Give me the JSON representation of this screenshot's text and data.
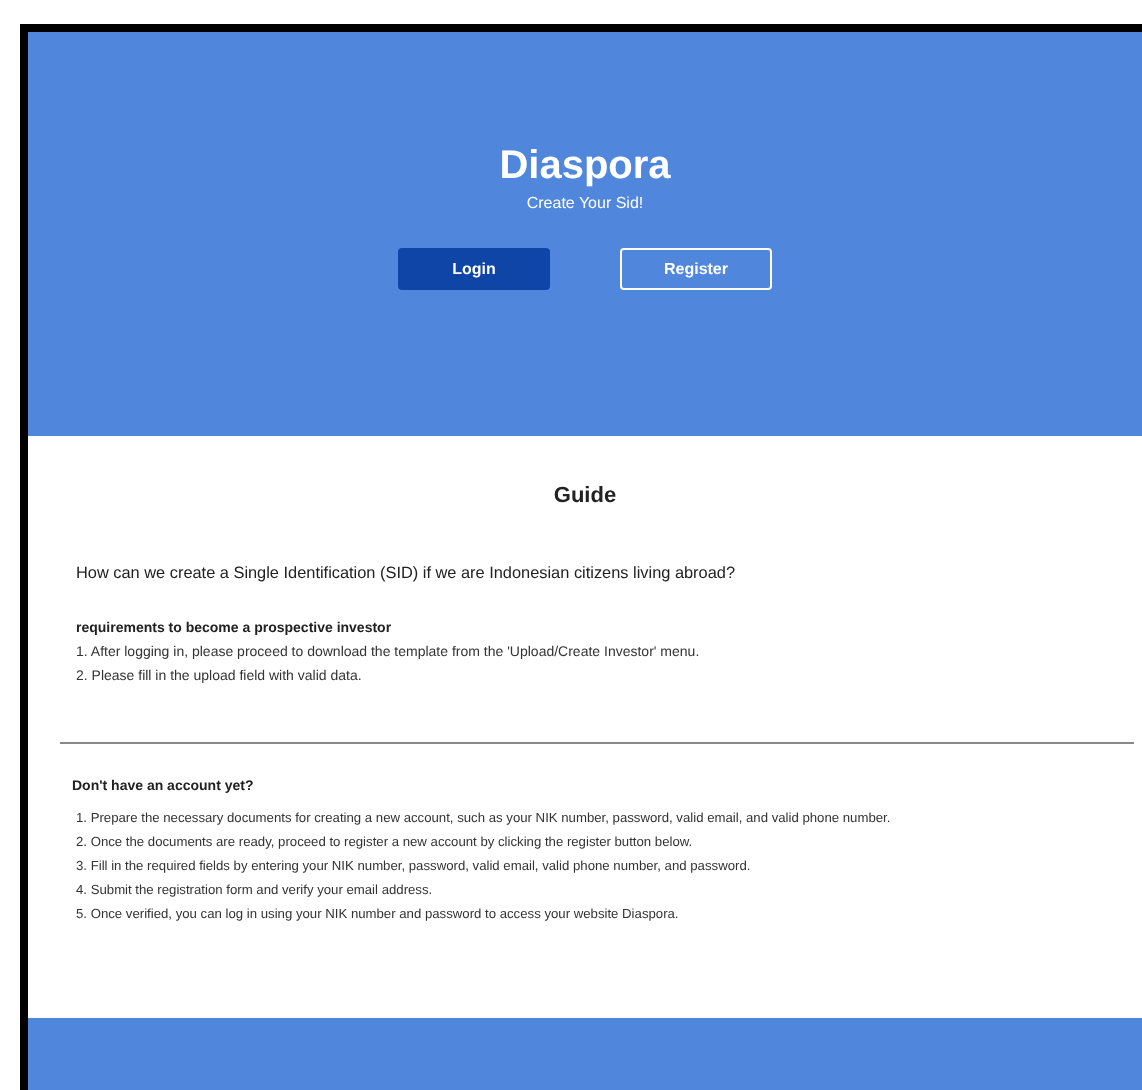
{
  "hero": {
    "title": "Diaspora",
    "subtitle": "Create Your Sid!",
    "buttons": [
      {
        "label": "Login",
        "kind": "solid"
      },
      {
        "label": "Register",
        "kind": "outline"
      }
    ]
  },
  "guide": {
    "title": "Guide",
    "question": "How can we create a Single Identification (SID) if we are Indonesian citizens living abroad?",
    "requirements_heading": "requirements to become a prospective investor",
    "requirements": [
      "1. After logging in, please proceed to download the template from the 'Upload/Create Investor' menu.",
      "2. Please fill in the upload field with valid data."
    ],
    "account_heading": "Don't have an account yet?",
    "account_steps": [
      "1. Prepare the necessary documents for creating a new account, such as your NIK number, password, valid email, and valid phone number.",
      "2. Once the documents are ready, proceed to register a new account by clicking the register button below.",
      "3. Fill in the required fields by entering your NIK number, password, valid email, valid phone number, and password.",
      "4. Submit the registration form and verify your email address.",
      "5. Once verified, you can log in using your NIK number and password to access your website Diaspora."
    ]
  }
}
